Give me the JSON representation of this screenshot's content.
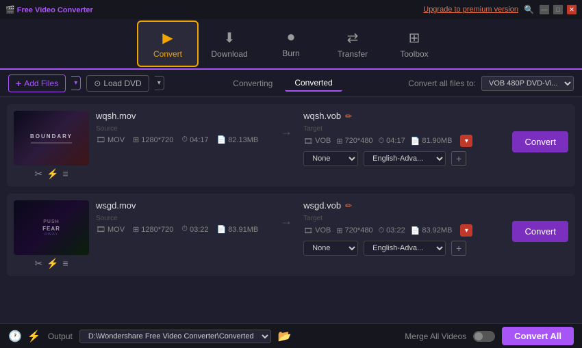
{
  "app": {
    "title": "Free Video Converter",
    "upgrade_label": "Upgrade to premium version"
  },
  "navbar": {
    "items": [
      {
        "id": "convert",
        "label": "Convert",
        "icon": "▶",
        "active": true
      },
      {
        "id": "download",
        "label": "Download",
        "icon": "⬇",
        "active": false
      },
      {
        "id": "burn",
        "label": "Burn",
        "icon": "⏺",
        "active": false
      },
      {
        "id": "transfer",
        "label": "Transfer",
        "icon": "⇄",
        "active": false
      },
      {
        "id": "toolbox",
        "label": "Toolbox",
        "icon": "⊞",
        "active": false
      }
    ]
  },
  "toolbar": {
    "add_files_label": "Add Files",
    "load_dvd_label": "Load DVD",
    "tab_converting": "Converting",
    "tab_converted": "Converted",
    "convert_all_files_label": "Convert all files to:",
    "convert_all_format": "VOB 480P DVD-Vi..."
  },
  "files": [
    {
      "id": "file1",
      "name": "wqsh.mov",
      "source": {
        "format": "MOV",
        "resolution": "1280*720",
        "duration": "04:17",
        "size": "82.13MB"
      },
      "target_name": "wqsh.vob",
      "target": {
        "format": "VOB",
        "resolution": "720*480",
        "duration": "04:17",
        "size": "81.90MB"
      },
      "subtitle_option": "None",
      "audio_option": "English-Adva...",
      "thumb_class": "thumb-1",
      "thumb_text": "BOUNDARY"
    },
    {
      "id": "file2",
      "name": "wsgd.mov",
      "source": {
        "format": "MOV",
        "resolution": "1280*720",
        "duration": "03:22",
        "size": "83.91MB"
      },
      "target_name": "wsgd.vob",
      "target": {
        "format": "VOB",
        "resolution": "720*480",
        "duration": "03:22",
        "size": "83.92MB"
      },
      "subtitle_option": "None",
      "audio_option": "English-Adva...",
      "thumb_class": "thumb-2",
      "thumb_text": "FEAR"
    }
  ],
  "bottombar": {
    "output_label": "Output",
    "output_path": "D:\\Wondershare Free Video Converter\\Converted",
    "merge_label": "Merge All Videos",
    "convert_all_btn": "Convert All"
  },
  "buttons": {
    "convert": "Convert",
    "convert_all": "Convert All"
  }
}
